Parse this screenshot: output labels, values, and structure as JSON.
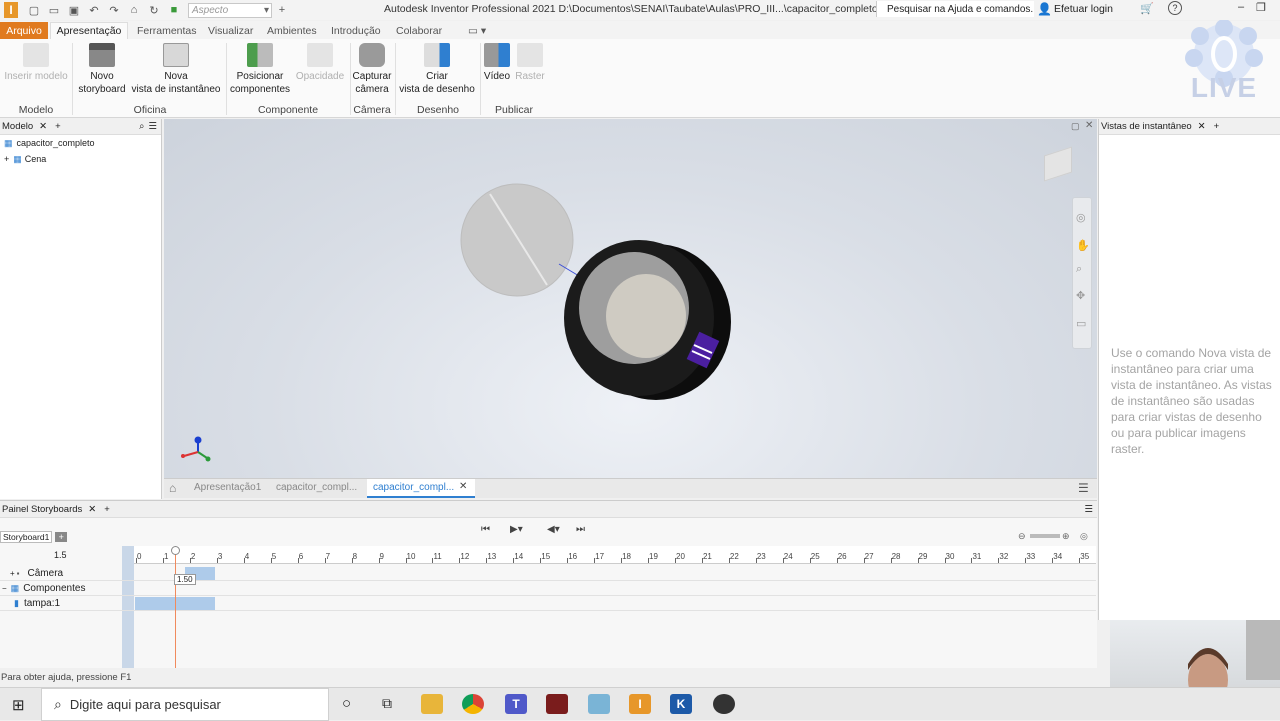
{
  "window": {
    "title": "Autodesk Inventor Professional 2021   D:\\Documentos\\SENAI\\Taubate\\Aulas\\PRO_III...\\capacitor_completo",
    "search_placeholder": "Pesquisar na Ajuda e comandos...",
    "login_label": "Efetuar login",
    "aspect_value": "Aspecto"
  },
  "tabs": [
    "Arquivo",
    "Apresentação",
    "Ferramentas",
    "Visualizar",
    "Ambientes",
    "Introdução",
    "Colaborar"
  ],
  "ribbon": {
    "buttons": {
      "insert_model": "Inserir modelo",
      "new_storyboard": "Novo\nstoryboard",
      "new_snapshot": "Nova\nvista de instantâneo",
      "position_components": "Posicionar\ncomponentes",
      "opacity": "Opacidade",
      "capture_camera": "Capturar\ncâmera",
      "create_drawing": "Criar\nvista de desenho",
      "video": "Vídeo",
      "raster": "Raster"
    },
    "groups": {
      "model": "Modelo",
      "workshop": "Oficina",
      "component": "Componente",
      "camera": "Câmera",
      "drawing": "Desenho",
      "publish": "Publicar"
    }
  },
  "model_panel": {
    "title": "Modelo",
    "items": [
      "capacitor_completo",
      "Cena"
    ]
  },
  "doc_tabs": [
    "Apresentação1",
    "capacitor_compl...",
    "capacitor_compl..."
  ],
  "right_panel": {
    "title": "Vistas de instantâneo",
    "message": "Use o comando Nova vista de instantâneo para criar uma vista de instantâneo. As vistas de instantâneo são usadas para criar vistas de desenho ou para publicar imagens raster."
  },
  "storyboard": {
    "panel_title": "Painel Storyboards",
    "tab_label": "Storyboard1",
    "current_time": "1.5",
    "time_tooltip": "1.50",
    "ticks": [
      "0",
      "1",
      "2",
      "3",
      "4",
      "5",
      "6",
      "7",
      "8",
      "9",
      "10",
      "11",
      "12",
      "13",
      "14",
      "15",
      "16",
      "17",
      "18",
      "19",
      "20",
      "21",
      "22",
      "23",
      "24",
      "25",
      "26",
      "27",
      "28",
      "29",
      "30",
      "31",
      "32",
      "33",
      "34",
      "35"
    ],
    "tracks": [
      "Câmera",
      "Componentes",
      "tampa:1"
    ]
  },
  "status": {
    "text": "Para obter ajuda, pressione F1"
  },
  "taskbar": {
    "search_placeholder": "Digite aqui para pesquisar"
  },
  "overlay": {
    "live_label": "LIVE"
  },
  "colors": {
    "file_tab": "#e07a1f",
    "accent_blue": "#2f7fd0",
    "track_bar": "#aecbea"
  }
}
